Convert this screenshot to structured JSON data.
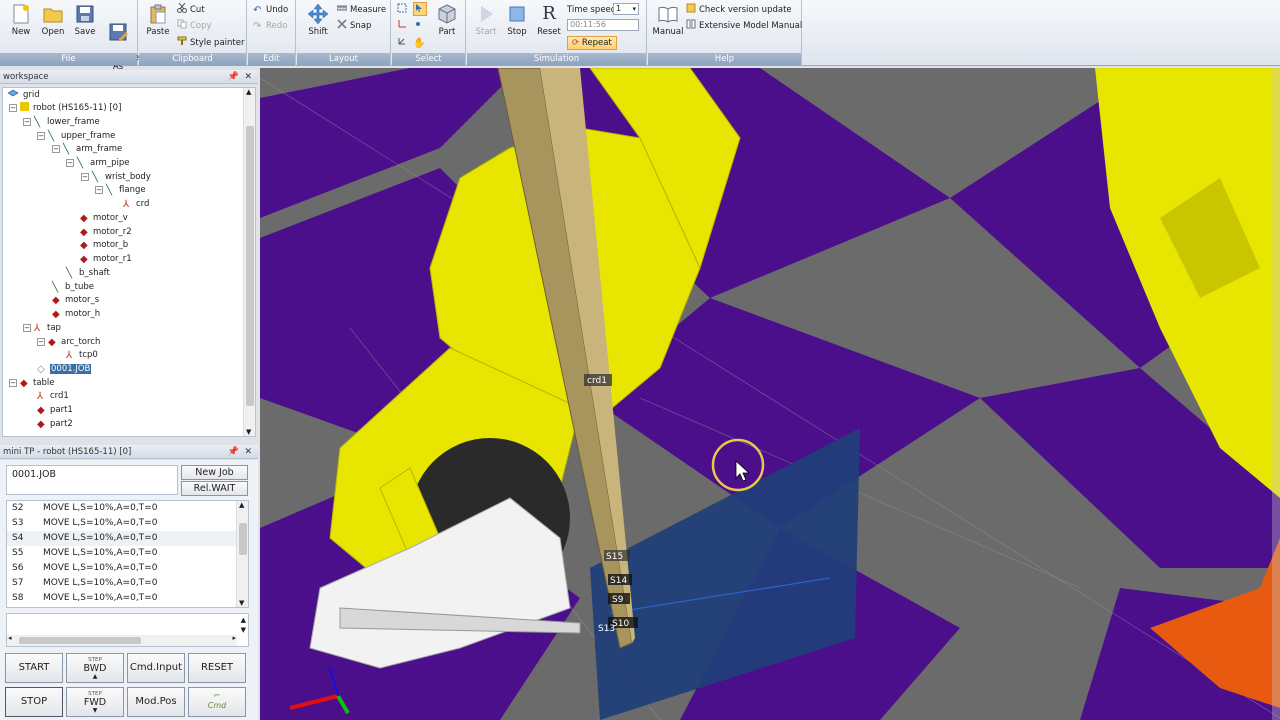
{
  "ribbon": {
    "file": {
      "label": "File",
      "new": "New",
      "open": "Open",
      "save": "Save",
      "save_as": "Save\nAs"
    },
    "clipboard": {
      "label": "Clipboard",
      "paste": "Paste",
      "cut": "Cut",
      "copy": "Copy",
      "style_painter": "Style painter"
    },
    "edit": {
      "label": "Edit",
      "undo": "Undo",
      "redo": "Redo"
    },
    "layout": {
      "label": "Layout",
      "shift": "Shift",
      "measure": "Measure",
      "snap": "Snap"
    },
    "select": {
      "label": "Select",
      "part": "Part"
    },
    "simulation": {
      "label": "Simulation",
      "start": "Start",
      "stop": "Stop",
      "reset": "Reset",
      "time_speed_label": "Time speed",
      "time_speed_value": "1",
      "time_value": "00:11:56",
      "repeat": "Repeat"
    },
    "help": {
      "label": "Help",
      "manual": "Manual",
      "check_update": "Check version update",
      "extensive_manual": "Extensive Model Manual"
    }
  },
  "workspace": {
    "title": "workspace",
    "items": [
      {
        "label": "grid"
      },
      {
        "label": "robot (HS165-11) [0]"
      },
      {
        "label": "lower_frame"
      },
      {
        "label": "upper_frame"
      },
      {
        "label": "arm_frame"
      },
      {
        "label": "arm_pipe"
      },
      {
        "label": "wrist_body"
      },
      {
        "label": "flange"
      },
      {
        "label": "crd"
      },
      {
        "label": "motor_v"
      },
      {
        "label": "motor_r2"
      },
      {
        "label": "motor_b"
      },
      {
        "label": "motor_r1"
      },
      {
        "label": "b_shaft"
      },
      {
        "label": "b_tube"
      },
      {
        "label": "motor_s"
      },
      {
        "label": "motor_h"
      },
      {
        "label": "tap"
      },
      {
        "label": "arc_torch"
      },
      {
        "label": "tcp0"
      },
      {
        "label": "0001.JOB"
      },
      {
        "label": "table"
      },
      {
        "label": "crd1"
      },
      {
        "label": "part1"
      },
      {
        "label": "part2"
      }
    ]
  },
  "mini_tp": {
    "title": "mini TP - robot (HS165-11) [0]",
    "job_name": "0001.JOB",
    "new_job": "New Job",
    "rel_wait": "Rel.WAIT",
    "lines": [
      {
        "num": "S2",
        "text": "MOVE L,S=10%,A=0,T=0"
      },
      {
        "num": "S3",
        "text": "MOVE L,S=10%,A=0,T=0"
      },
      {
        "num": "S4",
        "text": "MOVE L,S=10%,A=0,T=0"
      },
      {
        "num": "S5",
        "text": "MOVE L,S=10%,A=0,T=0"
      },
      {
        "num": "S6",
        "text": "MOVE L,S=10%,A=0,T=0"
      },
      {
        "num": "S7",
        "text": "MOVE L,S=10%,A=0,T=0"
      },
      {
        "num": "S8",
        "text": "MOVE L,S=10%,A=0,T=0"
      }
    ],
    "start": "START",
    "bwd_small": "STEP",
    "bwd": "BWD",
    "cmd_input": "Cmd.Input",
    "reset": "RESET",
    "stop": "STOP",
    "fwd_small": "STEP",
    "fwd": "FWD",
    "mod_pos": "Mod.Pos",
    "cmd_icon": "Cmd"
  },
  "viewport": {
    "crd_label": "crd1",
    "step_labels": [
      "S15",
      "S14",
      "S9",
      "S10",
      "S13"
    ]
  },
  "colors": {
    "floor_purple": "#4b0f8c",
    "floor_gray": "#6b6b6b",
    "robot_yellow": "#e8e600",
    "plate_blue": "#1f3f7a",
    "torch_bar": "#a8955e",
    "orange": "#e85a10"
  }
}
